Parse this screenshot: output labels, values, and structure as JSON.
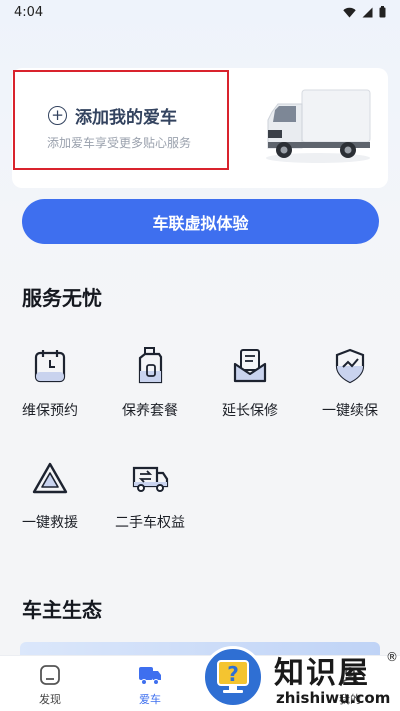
{
  "status_bar": {
    "time": "4:04",
    "icons": [
      "wifi-icon",
      "signal-icon",
      "battery-icon"
    ]
  },
  "vehicle_card": {
    "title": "添加我的爱车",
    "subtitle": "添加爱车享受更多贴心服务",
    "plus_icon": "+",
    "image": "truck-image"
  },
  "primary_button": {
    "label": "车联虚拟体验"
  },
  "services_section": {
    "title": "服务无忧",
    "items": [
      {
        "label": "维保预约",
        "icon": "calendar-icon"
      },
      {
        "label": "保养套餐",
        "icon": "oil-bottle-icon"
      },
      {
        "label": "延长保修",
        "icon": "envelope-icon"
      },
      {
        "label": "一键续保",
        "icon": "shield-chart-icon"
      },
      {
        "label": "一键救援",
        "icon": "warning-triangle-icon"
      },
      {
        "label": "二手车权益",
        "icon": "truck-exchange-icon"
      }
    ]
  },
  "ecosystem_section": {
    "title": "车主生态"
  },
  "tab_bar": {
    "tabs": [
      {
        "label": "发现",
        "icon": "discover-icon",
        "active": false
      },
      {
        "label": "爱车",
        "icon": "truck-tab-icon",
        "active": true
      },
      {
        "label": "",
        "icon": "service-tab-icon",
        "active": false
      },
      {
        "label": "我的",
        "icon": "profile-tab-icon",
        "active": false
      }
    ]
  },
  "watermark": {
    "title": "知识屋",
    "registered": "®",
    "url": "zhishiwu.com"
  },
  "colors": {
    "accent": "#3e6fef",
    "highlight_border": "#d9232d",
    "card_title": "#33435f"
  }
}
